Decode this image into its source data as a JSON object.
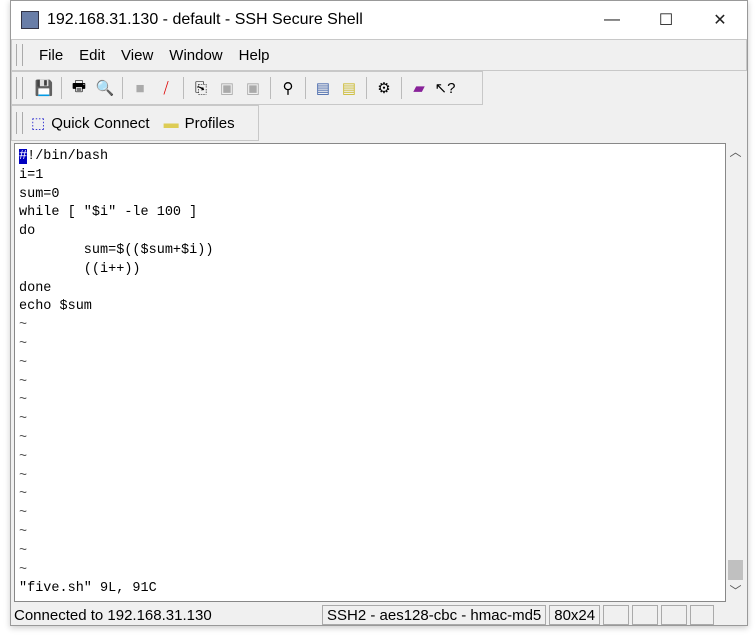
{
  "window": {
    "title": "192.168.31.130 - default - SSH Secure Shell",
    "minimize": "—",
    "maximize": "☐",
    "close": "✕"
  },
  "menu": [
    "File",
    "Edit",
    "View",
    "Window",
    "Help"
  ],
  "toolbar_icons": [
    "save-icon",
    "print-icon",
    "print-preview-icon",
    "disconnect-icon",
    "new-connection-disabled-icon",
    "copy-icon",
    "paste-icon",
    "paste-disabled-icon",
    "find-icon",
    "new-terminal-icon",
    "new-file-transfer-icon",
    "settings-icon",
    "help-book-icon",
    "context-help-icon"
  ],
  "quickbar": {
    "quick_connect": "Quick Connect",
    "profiles": "Profiles"
  },
  "terminal": {
    "cursor_char": "#",
    "first_line_rest": "!/bin/bash",
    "lines": [
      "i=1",
      "sum=0",
      "while [ \"$i\" -le 100 ]",
      "do",
      "        sum=$(($sum+$i))",
      "        ((i++))",
      "done",
      "echo $sum"
    ],
    "tilde": "~",
    "tilde_count": 14,
    "status_line": "\"five.sh\" 9L, 91C"
  },
  "statusbar": {
    "connection": "Connected to 192.168.31.130",
    "cipher": "SSH2 - aes128-cbc - hmac-md5",
    "size": "80x24"
  }
}
